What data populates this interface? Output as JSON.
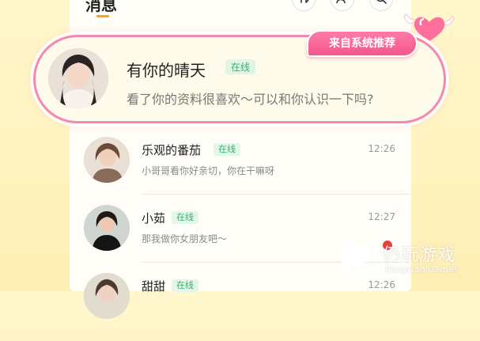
{
  "header": {
    "title": "消息",
    "buttons": [
      {
        "icon": "sort-icon"
      },
      {
        "icon": "add-friend-icon"
      },
      {
        "icon": "search-icon"
      }
    ]
  },
  "recommended": {
    "badge": "来自系统推荐",
    "name": "有你的晴天",
    "status": "在线",
    "message": "看了你的资料很喜欢～可以和你认识一下吗?"
  },
  "conversations": [
    {
      "name": "乐观的番茄",
      "status": "在线",
      "time": "12:26",
      "message": "小哥哥看你好亲切，你在干嘛呀"
    },
    {
      "name": "小茹",
      "status": "在线",
      "time": "12:27",
      "message": "那我做你女朋友吧～"
    },
    {
      "name": "甜甜",
      "status": "在线",
      "time": "12:26",
      "message": ""
    }
  ],
  "watermark": {
    "text": "仍玩游戏",
    "sub": "Rengwan Games"
  },
  "colors": {
    "accent_pink": "#f2578b",
    "online_green": "#39b06a",
    "tab_indicator": "#ff9f1c",
    "unread_red": "#e8423f"
  }
}
